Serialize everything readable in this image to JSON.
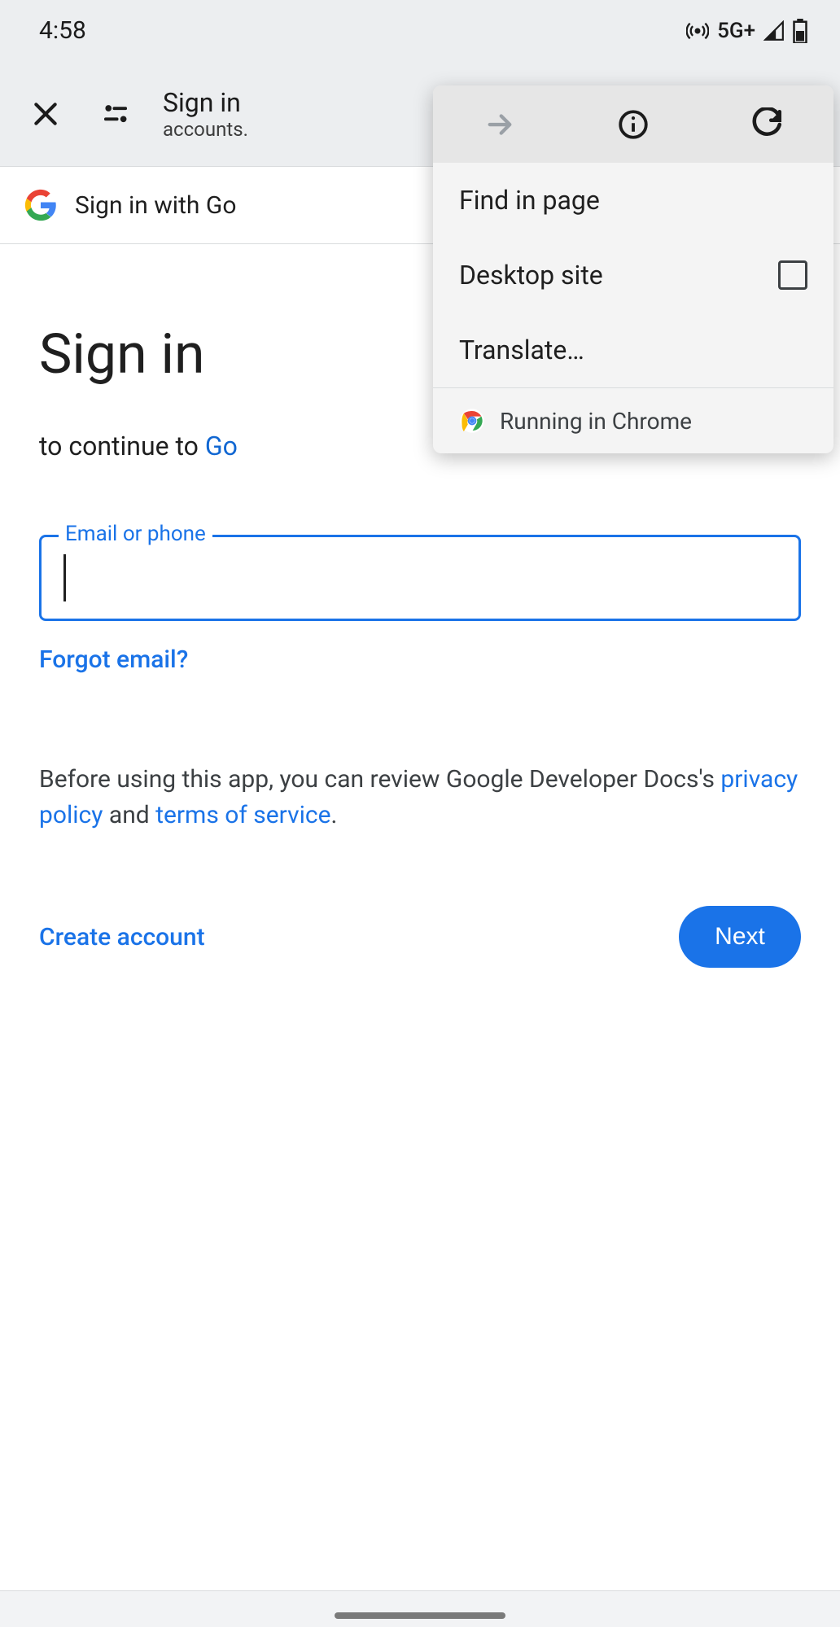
{
  "status": {
    "time": "4:58",
    "network": "5G+"
  },
  "appbar": {
    "title": "Sign in",
    "subtitle": "accounts."
  },
  "banner": {
    "text": "Sign in with Go"
  },
  "page": {
    "heading": "Sign in",
    "subtitle_prefix": "to continue to ",
    "subtitle_link": "Go",
    "field_label": "Email or phone",
    "field_value": "",
    "forgot": "Forgot email?",
    "disclosure_pre": "Before using this app, you can review Google Developer Docs's ",
    "privacy": "privacy policy",
    "disclosure_mid": " and ",
    "tos": "terms of service",
    "disclosure_post": ".",
    "create": "Create account",
    "next": "Next"
  },
  "menu": {
    "find": "Find in page",
    "desktop": "Desktop site",
    "translate": "Translate…",
    "running": "Running in Chrome"
  }
}
